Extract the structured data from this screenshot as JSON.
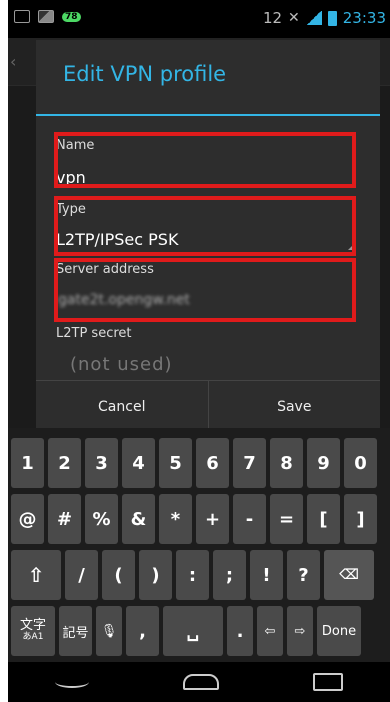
{
  "status_bar": {
    "badge": "78",
    "number": "12",
    "time": "23:33"
  },
  "dialog": {
    "title": "Edit VPN profile",
    "fields": [
      {
        "label": "Name",
        "value": "vpn"
      },
      {
        "label": "Type",
        "value": "L2TP/IPSec PSK"
      },
      {
        "label": "Server address",
        "value": "gate2t.opengw.net"
      },
      {
        "label": "L2TP secret",
        "placeholder": "(not used)"
      }
    ],
    "cancel_label": "Cancel",
    "save_label": "Save"
  },
  "keyboard": {
    "row1": [
      "1",
      "2",
      "3",
      "4",
      "5",
      "6",
      "7",
      "8",
      "9",
      "0"
    ],
    "row2": [
      "@",
      "#",
      "%",
      "&",
      "*",
      "+",
      "-",
      "=",
      "[",
      "]"
    ],
    "row3": [
      "/",
      "(",
      ")",
      ":",
      ";",
      "!",
      "?"
    ],
    "bottom": {
      "lang": "文字",
      "lang_sub": "あA1",
      "symbols": "記号",
      "comma": ",",
      "period": ".",
      "done": "Done"
    }
  },
  "highlight_color": "#e01b1b",
  "accent_color": "#33b5e5"
}
